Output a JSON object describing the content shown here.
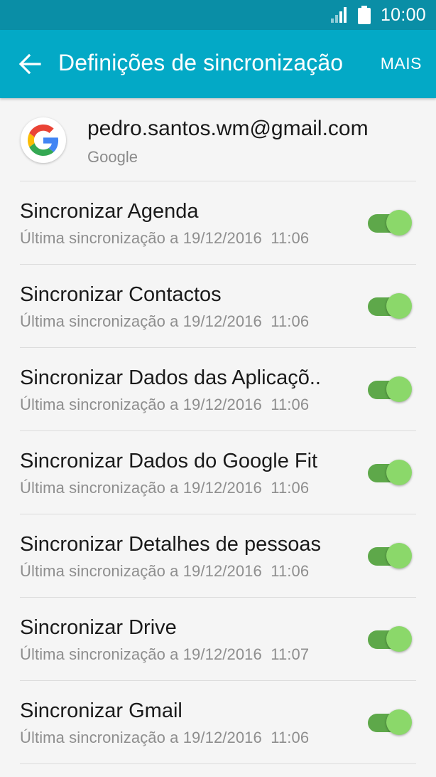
{
  "status_bar": {
    "time": "10:00",
    "icons": [
      "signal-icon",
      "battery-icon"
    ]
  },
  "app_bar": {
    "back_icon": "arrow-left-icon",
    "title": "Definições de sincronização",
    "more_label": "MAIS"
  },
  "account": {
    "icon": "google-logo-icon",
    "email": "pedro.santos.wm@gmail.com",
    "type": "Google"
  },
  "colors": {
    "status_bar": "#0a8ea6",
    "app_bar": "#03a9c6",
    "toggle_track": "#5ea84a",
    "toggle_thumb": "#8bd86a"
  },
  "sync_items": [
    {
      "label": "Sincronizar Agenda",
      "last_sync": "Última sincronização a 19/12/2016  11:06",
      "enabled": true
    },
    {
      "label": "Sincronizar Contactos",
      "last_sync": "Última sincronização a 19/12/2016  11:06",
      "enabled": true
    },
    {
      "label": "Sincronizar Dados das Aplicaçõ..",
      "last_sync": "Última sincronização a 19/12/2016  11:06",
      "enabled": true
    },
    {
      "label": "Sincronizar Dados do Google Fit",
      "last_sync": "Última sincronização a 19/12/2016  11:06",
      "enabled": true
    },
    {
      "label": "Sincronizar Detalhes de pessoas",
      "last_sync": "Última sincronização a 19/12/2016  11:06",
      "enabled": true
    },
    {
      "label": "Sincronizar Drive",
      "last_sync": "Última sincronização a 19/12/2016  11:07",
      "enabled": true
    },
    {
      "label": "Sincronizar Gmail",
      "last_sync": "Última sincronização a 19/12/2016  11:06",
      "enabled": true
    }
  ]
}
